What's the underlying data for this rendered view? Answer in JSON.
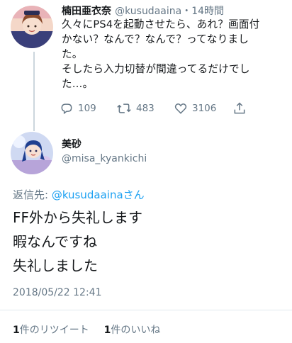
{
  "original_tweet": {
    "author_name": "楠田亜衣奈",
    "author_handle": "@kusudaaina",
    "separator": "・",
    "time_ago": "14時間",
    "text_lines": [
      "久々にPS4を起動させたら、あれ？画面付",
      "かない？なんで？なんで？ってなりまし",
      "た。",
      "そしたら入力切替が間違ってるだけでし",
      "た…。"
    ],
    "actions": {
      "replies": "109",
      "retweets": "483",
      "likes": "3106"
    },
    "icons": [
      "reply-icon",
      "retweet-icon",
      "like-icon",
      "share-icon"
    ]
  },
  "reply_tweet": {
    "author_name": "美砂",
    "author_handle": "@misa_kyankichi",
    "reply_prefix": "返信先: ",
    "reply_mention": "@kusudaaina",
    "reply_suffix": "さん",
    "text_lines": [
      "FF外から失礼します",
      "暇なんですね",
      "失礼しました"
    ],
    "timestamp": "2018/05/22 12:41",
    "retweet_count": "1",
    "retweet_label": "件のリツイート",
    "like_count": "1",
    "like_label": "件のいいね"
  },
  "colors": {
    "accent": "#1da1f2",
    "muted": "#657786",
    "text": "#14171a",
    "divider": "#e1e8ed"
  }
}
